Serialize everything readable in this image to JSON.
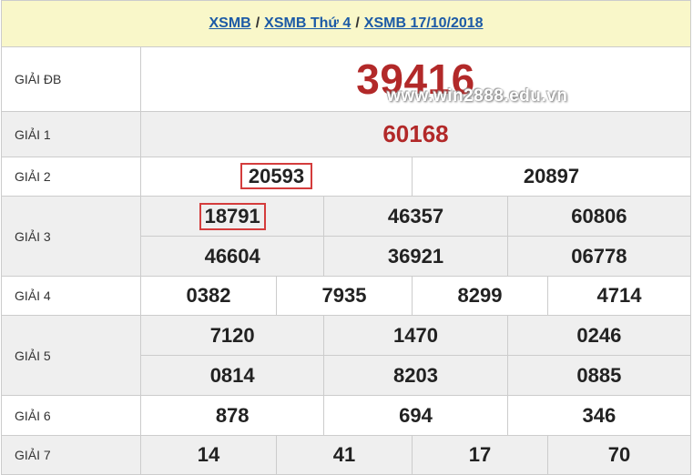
{
  "header": {
    "link1": "XSMB",
    "link2": "XSMB Thứ 4",
    "link3": "XSMB 17/10/2018",
    "sep": "/"
  },
  "watermark": "www.win2888.edu.vn",
  "prizes": {
    "db": {
      "label": "GIẢI ĐB",
      "values": [
        "39416"
      ]
    },
    "g1": {
      "label": "GIẢI 1",
      "values": [
        "60168"
      ]
    },
    "g2": {
      "label": "GIẢI 2",
      "values": [
        "20593",
        "20897"
      ]
    },
    "g3": {
      "label": "GIẢI 3",
      "values": [
        "18791",
        "46357",
        "60806",
        "46604",
        "36921",
        "06778"
      ]
    },
    "g4": {
      "label": "GIẢI 4",
      "values": [
        "0382",
        "7935",
        "8299",
        "4714"
      ]
    },
    "g5": {
      "label": "GIẢI 5",
      "values": [
        "7120",
        "1470",
        "0246",
        "0814",
        "8203",
        "0885"
      ]
    },
    "g6": {
      "label": "GIẢI 6",
      "values": [
        "878",
        "694",
        "346"
      ]
    },
    "g7": {
      "label": "GIẢI 7",
      "values": [
        "14",
        "41",
        "17",
        "70"
      ]
    }
  },
  "colors": {
    "header_bg": "#f9f7c9",
    "link": "#1c5aa6",
    "accent_red": "#b22929",
    "highlight_box": "#d43c3c",
    "row_grey": "#efefef"
  }
}
